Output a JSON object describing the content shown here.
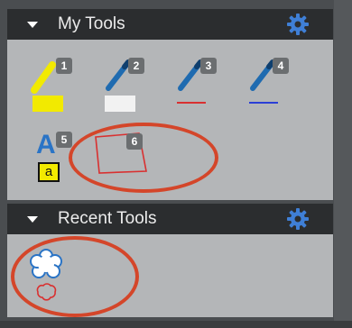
{
  "my_tools": {
    "title": "My Tools",
    "tools": [
      {
        "badge": "1",
        "icon": "yellow-highlighter-icon"
      },
      {
        "badge": "2",
        "icon": "white-highlighter-icon"
      },
      {
        "badge": "3",
        "icon": "red-pen-icon"
      },
      {
        "badge": "4",
        "icon": "blue-pen-icon"
      },
      {
        "badge": "5",
        "icon": "text-box-icon",
        "glyph_top": "A",
        "glyph_bottom": "a"
      },
      {
        "badge": "6",
        "icon": "polygon-icon"
      }
    ]
  },
  "recent_tools": {
    "title": "Recent Tools",
    "tools": [
      {
        "icon": "cloud-shape-icon"
      }
    ]
  },
  "colors": {
    "header_bg": "#2b2d2f",
    "panel_bg": "#b4b6b8",
    "highlight_circle": "#d4462a",
    "gear": "#3f7fd6"
  }
}
